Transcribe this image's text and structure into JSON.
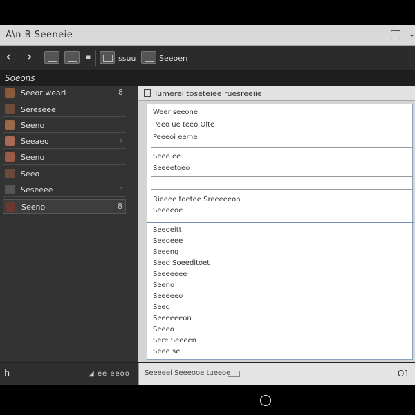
{
  "window": {
    "title": "A\\n B Seeneie"
  },
  "toolbar": {
    "tool1": "ssuu",
    "tool2": "Seeoerr"
  },
  "sidebar": {
    "header": "Soeons",
    "items": [
      {
        "label": "Seeor wearl",
        "indicator": "8",
        "thumb": "#8a5a3c"
      },
      {
        "label": "Sereseee",
        "indicator": "'",
        "thumb": "#6d4a3a"
      },
      {
        "label": "Seeno",
        "indicator": "'",
        "thumb": "#9a6a48"
      },
      {
        "label": "Seeaeo",
        "indicator": "◦",
        "thumb": "#a86a54"
      },
      {
        "label": "Seeno",
        "indicator": "'",
        "thumb": "#9a5a48"
      },
      {
        "label": "Seeo",
        "indicator": "'",
        "thumb": "#6a4a3c"
      },
      {
        "label": "Seseeee",
        "indicator": "◦",
        "thumb": "#555555"
      },
      {
        "label": "Seeno",
        "indicator": "8",
        "thumb": "#6a3a30"
      }
    ]
  },
  "main": {
    "header": "Iumerei toseteiee ruesreeiie",
    "section1": [
      "Weer seeone",
      "Peeo ue teeo Olte",
      "Peeeoi eeme"
    ],
    "section2": [
      "Seoe ee",
      "Seeeetoeo"
    ],
    "section3": [
      "Rieeee toetee Sreeeeeon",
      "Seeeeoe"
    ],
    "list": [
      "Seeoeitt",
      "Seeoeee",
      "Seeeng",
      "Seed Soeeditoet",
      "Seeeeeee",
      "Seeno",
      "Seeeeeo",
      "Seed",
      "Seeeeeeon",
      "Seeeo",
      "Sere Seeeen",
      "Seee se"
    ]
  },
  "status": {
    "left_glyph": "h",
    "zoom": "◢ ee eeoo",
    "text": "Seeeeei Seeeooe tueeoe",
    "count": "O1"
  }
}
